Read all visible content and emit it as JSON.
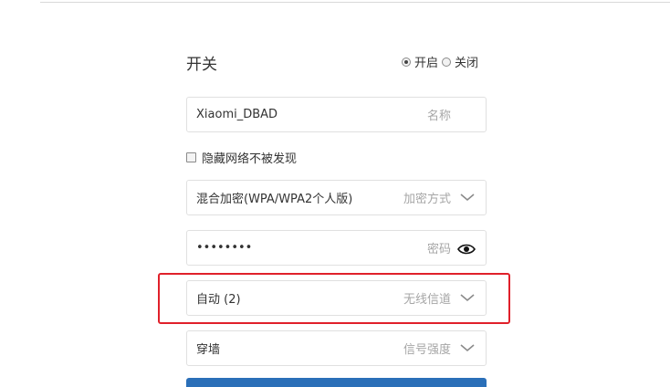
{
  "switch": {
    "title": "开关",
    "on_label": "开启",
    "off_label": "关闭",
    "selected": "开启"
  },
  "ssid": {
    "value": "Xiaomi_DBAD",
    "hint": "名称"
  },
  "hide_network": {
    "label": "隐藏网络不被发现",
    "checked": false
  },
  "encryption": {
    "value": "混合加密(WPA/WPA2个人版)",
    "hint": "加密方式",
    "icon": "chevron-down-icon"
  },
  "password": {
    "value": "••••••••",
    "hint": "密码",
    "icon": "eye-icon"
  },
  "channel": {
    "value": "自动 (2)",
    "hint": "无线信道",
    "icon": "chevron-down-icon"
  },
  "signal": {
    "value": "穿墙",
    "hint": "信号强度",
    "icon": "chevron-down-icon"
  },
  "colors": {
    "highlight": "#e0202a",
    "primary": "#2a6fb8",
    "border": "#e0e0e0",
    "hint": "#a6a6a6"
  }
}
